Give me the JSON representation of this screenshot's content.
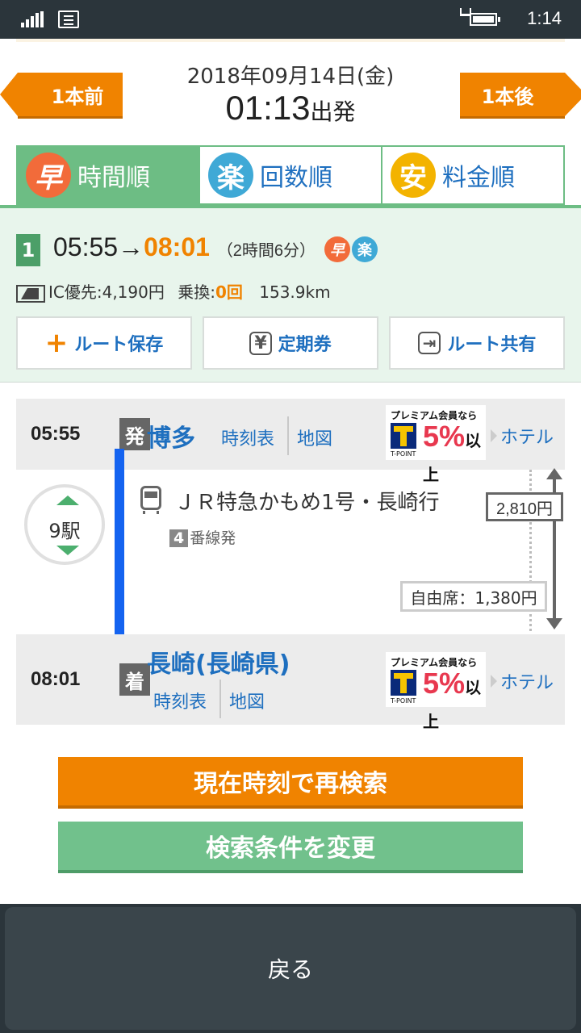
{
  "status": {
    "time": "1:14"
  },
  "header": {
    "prev_label": "1本前",
    "next_label": "1本後",
    "date": "2018年09月14日(金)",
    "dep_time": "01:13",
    "dep_suffix": "出発"
  },
  "tabs": [
    {
      "badge": "早",
      "label": "時間順",
      "active": true
    },
    {
      "badge": "楽",
      "label": "回数順",
      "active": false
    },
    {
      "badge": "安",
      "label": "料金順",
      "active": false
    }
  ],
  "route": {
    "number": "1",
    "dep": "05:55",
    "arrow": "→",
    "arr": "08:01",
    "duration": "（2時間6分）",
    "badges": [
      "早",
      "楽"
    ],
    "fare_label": "IC優先:4,190円",
    "transfer_label": "乗換:",
    "transfer_count": "0回",
    "distance": "153.9km",
    "actions": {
      "save": "ルート保存",
      "pass": "定期券",
      "share": "ルート共有",
      "pass_icon": "¥"
    }
  },
  "departure": {
    "time": "05:55",
    "mark": "発",
    "station": "博多",
    "timetable": "時刻表",
    "map": "地図",
    "hotel": "ホテル"
  },
  "segment": {
    "stops": "9駅",
    "train": "ＪＲ特急かもめ1号・長崎行",
    "platform_num": "4",
    "platform_suffix": "番線発",
    "fare": "2,810円",
    "seat_fare": "自由席：1,380円"
  },
  "arrival": {
    "time": "08:01",
    "mark": "着",
    "station": "長崎(長崎県)",
    "timetable": "時刻表",
    "map": "地図",
    "hotel": "ホテル"
  },
  "promo": {
    "head": "プレミアム会員なら",
    "pct": "5%",
    "suffix": "以上",
    "foot": "T-POINT"
  },
  "buttons": {
    "research": "現在時刻で再検索",
    "change": "検索条件を変更",
    "back": "戻る"
  }
}
